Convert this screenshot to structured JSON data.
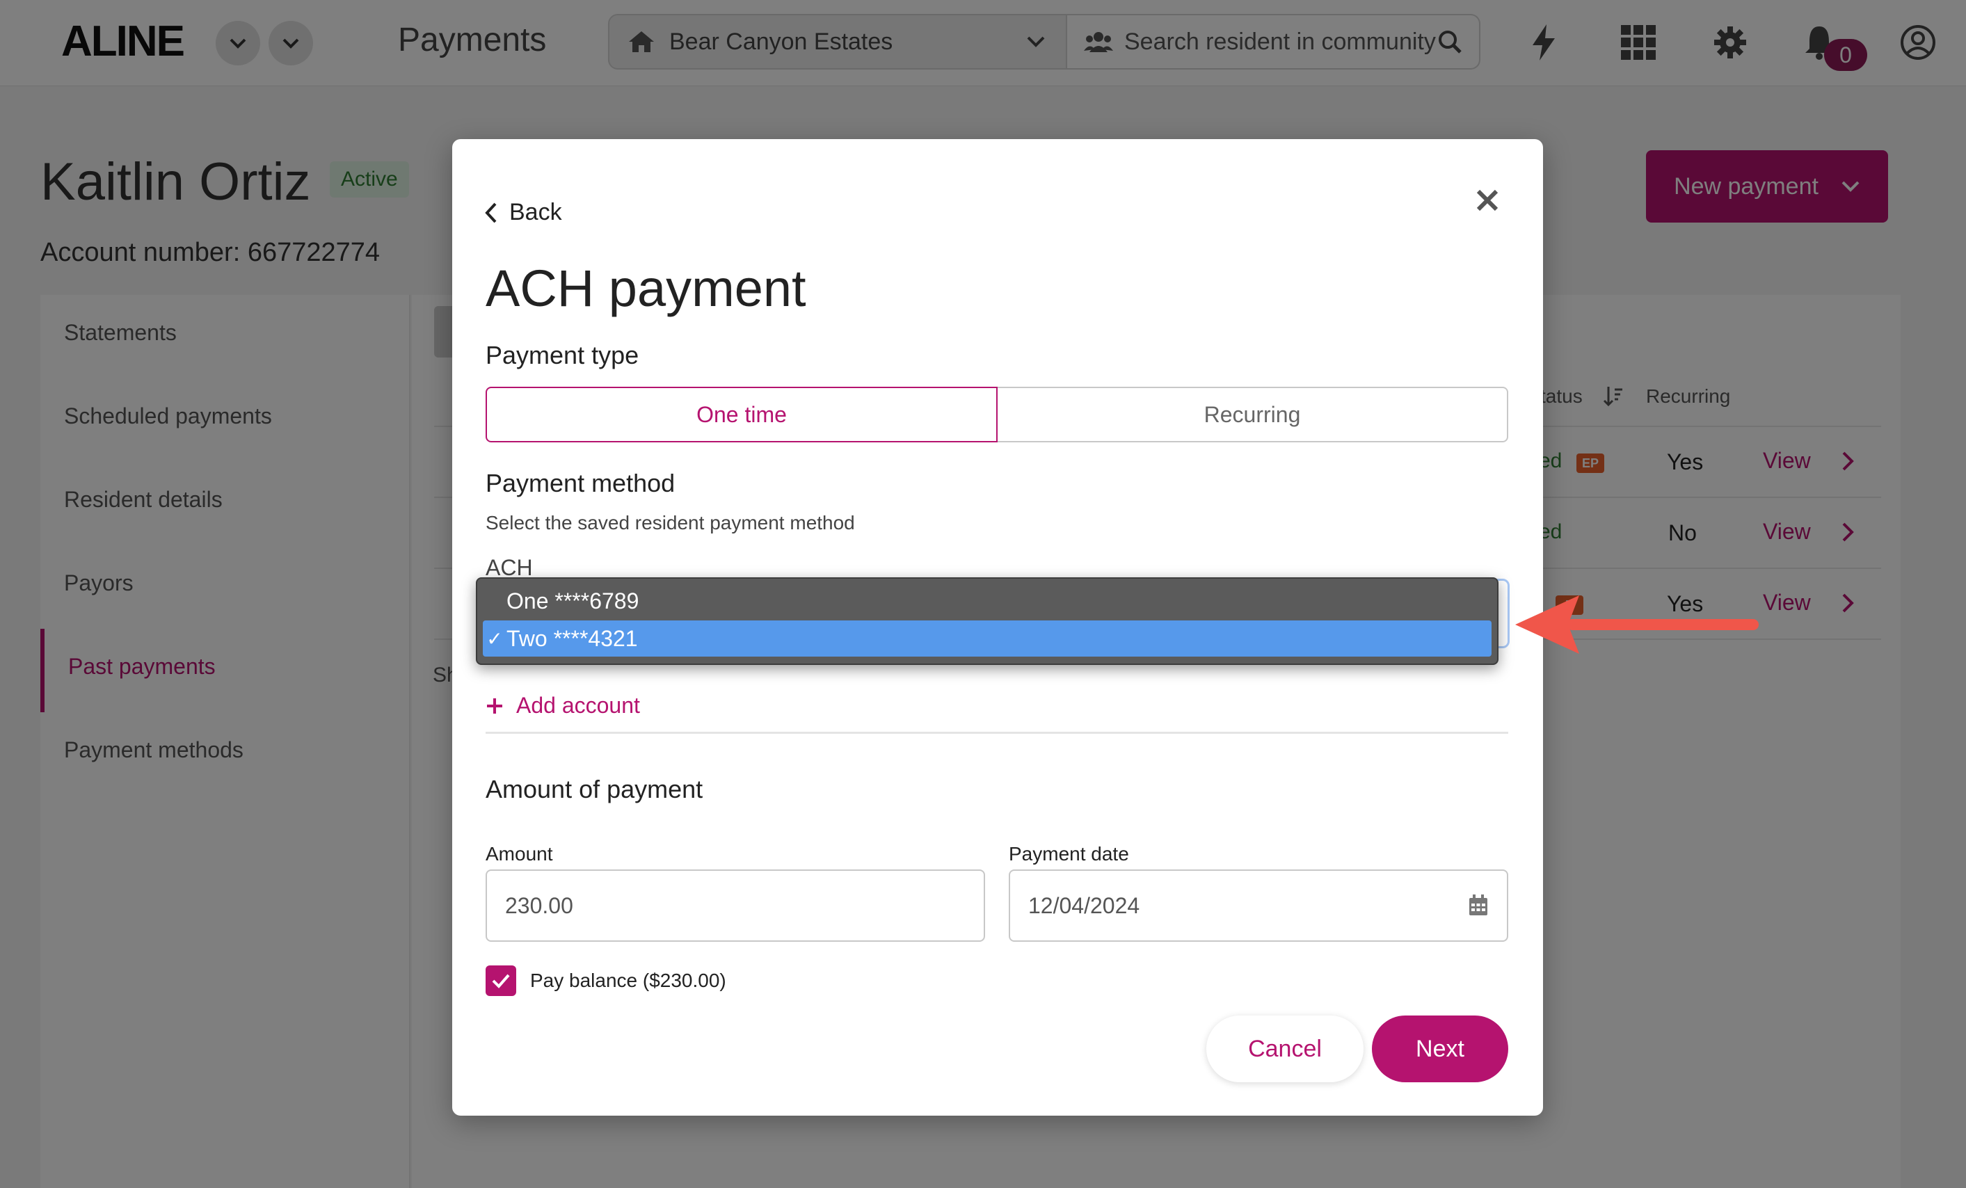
{
  "app": {
    "logo": "ALINE",
    "page_title": "Payments"
  },
  "header": {
    "community": "Bear Canyon Estates",
    "search_placeholder": "Search resident in community",
    "notification_count": "0"
  },
  "resident": {
    "name": "Kaitlin Ortiz",
    "status": "Active",
    "account_number": "Account number: 667722774"
  },
  "new_payment_label": "New payment",
  "sidebar": {
    "items": [
      {
        "label": "Statements"
      },
      {
        "label": "Scheduled payments"
      },
      {
        "label": "Resident details"
      },
      {
        "label": "Payors"
      },
      {
        "label": "Past payments",
        "active": true
      },
      {
        "label": "Payment methods"
      }
    ]
  },
  "table": {
    "headers": {
      "status": "tatus",
      "recurring": "Recurring"
    },
    "rows": [
      {
        "status_fragment": "ed",
        "badge": "EP",
        "recurring": "Yes",
        "action": "View"
      },
      {
        "status_fragment": "ed",
        "badge": "",
        "recurring": "No",
        "action": "View"
      },
      {
        "status_fragment": "",
        "badge": "P",
        "recurring": "Yes",
        "action": "View"
      }
    ],
    "footer_fragment": "Sh"
  },
  "modal": {
    "back_label": "Back",
    "title": "ACH payment",
    "payment_type_label": "Payment type",
    "payment_types": {
      "one_time": "One time",
      "recurring": "Recurring"
    },
    "payment_method_label": "Payment method",
    "payment_method_help": "Select the saved resident payment method",
    "ach_label": "ACH",
    "ach_options": [
      {
        "label": "One ****6789",
        "selected": false,
        "check": ""
      },
      {
        "label": "Two ****4321",
        "selected": true,
        "check": "✓"
      }
    ],
    "add_account_label": "Add account",
    "amount_section_label": "Amount of payment",
    "amount_label": "Amount",
    "amount_value": "230.00",
    "date_label": "Payment date",
    "date_value": "12/04/2024",
    "pay_balance_label": "Pay balance ($230.00)",
    "pay_balance_checked": true,
    "cancel_label": "Cancel",
    "next_label": "Next"
  },
  "colors": {
    "accent": "#b5136f",
    "dropdown_selected": "#5699eb",
    "annotation_arrow": "#f0564a"
  }
}
